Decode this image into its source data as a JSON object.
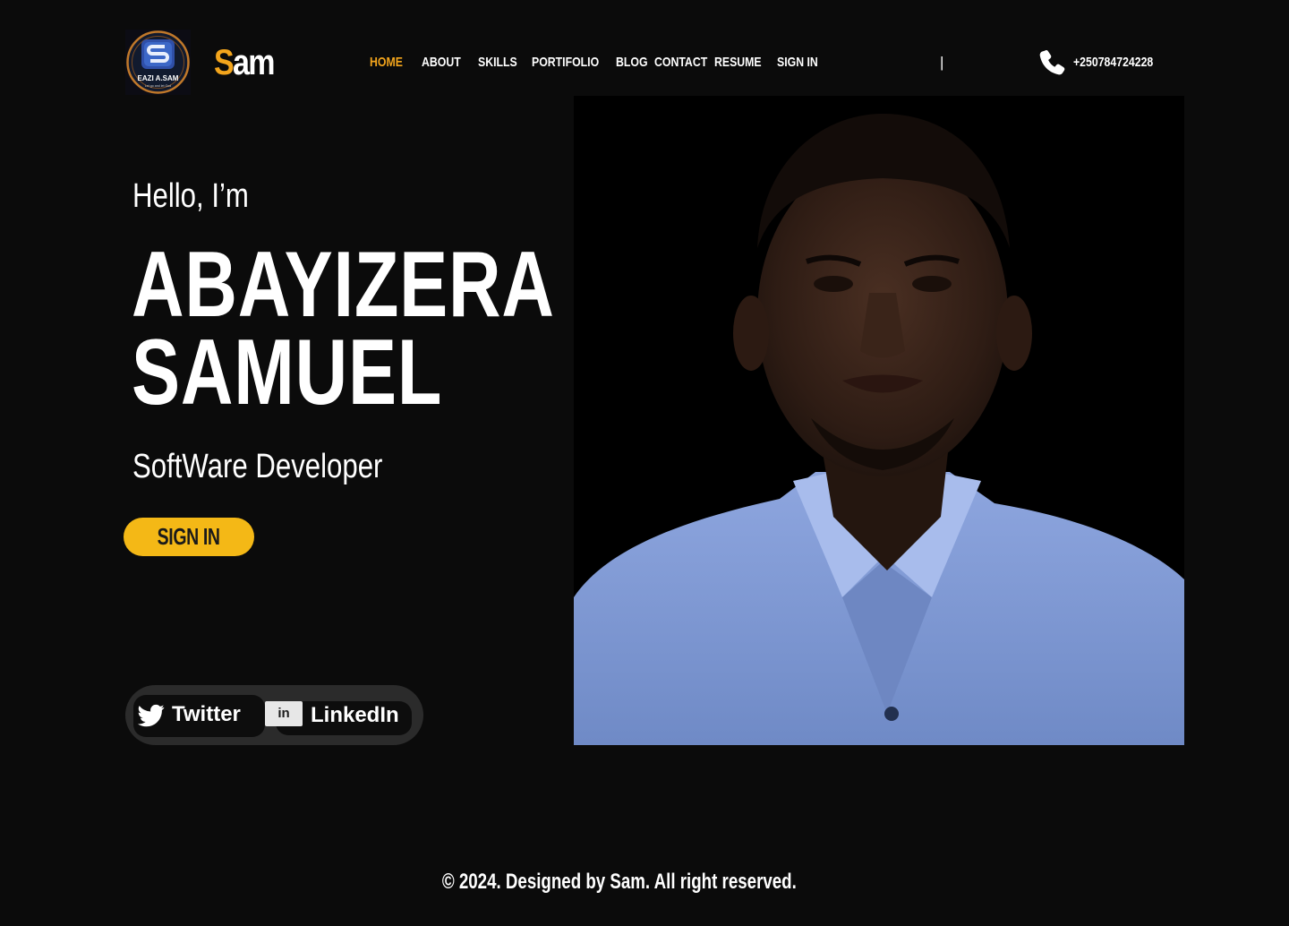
{
  "header": {
    "logo": {
      "initial": "S",
      "text": "EAZI A.SAM",
      "tagline": "Let go and let God"
    },
    "brand": {
      "first": "S",
      "rest": "am"
    },
    "nav": [
      {
        "label": "HOME",
        "active": true
      },
      {
        "label": "ABOUT",
        "active": false
      },
      {
        "label": "SKILLS",
        "active": false
      },
      {
        "label": "PORTIFOLIO",
        "active": false
      },
      {
        "label": "BLOG",
        "active": false
      },
      {
        "label": "CONTACT",
        "active": false
      },
      {
        "label": "RESUME",
        "active": false
      },
      {
        "label": "SIGN IN",
        "active": false
      }
    ],
    "divider": "|",
    "phone_icon": "phone-icon",
    "phone": "+250784724228"
  },
  "hero": {
    "greeting": "Hello, I’m",
    "name_line1": "ABAYIZERA",
    "name_line2": "SAMUEL",
    "role": "SoftWare Developer",
    "cta_label": "SIGN IN"
  },
  "social": {
    "twitter": {
      "label": "Twitter",
      "icon": "twitter-bird-icon"
    },
    "linkedin": {
      "label": "LinkedIn",
      "icon_text": "in"
    }
  },
  "footer": {
    "copyright": "© 2024. Designed by Sam. All right reserved."
  },
  "colors": {
    "background": "#0b0b0b",
    "accent": "#f3a51c",
    "button": "#f4b816",
    "pill": "#2b2b2b",
    "shirt": "#7d98d4"
  }
}
